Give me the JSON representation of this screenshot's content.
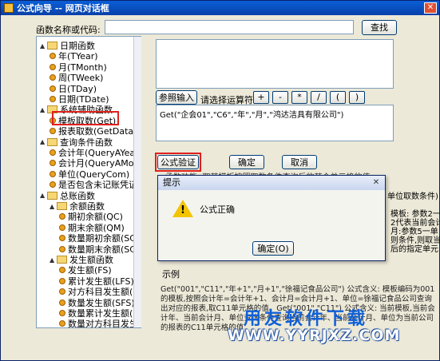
{
  "window": {
    "title": "公式向导 -- 网页对话框",
    "close_glyph": "✕"
  },
  "search": {
    "label": "函数名称或代码:",
    "value": "",
    "button": "查找"
  },
  "tree": {
    "items": [
      {
        "text": "日期函数",
        "kind": "folder",
        "expand": "▲",
        "level": 0
      },
      {
        "text": "年(TYear)",
        "kind": "leaf",
        "level": 1
      },
      {
        "text": "月(TMonth)",
        "kind": "leaf",
        "level": 1
      },
      {
        "text": "周(TWeek)",
        "kind": "leaf",
        "level": 1
      },
      {
        "text": "日(TDay)",
        "kind": "leaf",
        "level": 1
      },
      {
        "text": "日期(TDate)",
        "kind": "leaf",
        "level": 1
      },
      {
        "text": "系统辅助函数",
        "kind": "folder",
        "expand": "▲",
        "level": 0
      },
      {
        "text": "模板取数(Get)",
        "kind": "leaf",
        "level": 1
      },
      {
        "text": "报表取数(GetData)",
        "kind": "leaf",
        "level": 1
      },
      {
        "text": "查询条件函数",
        "kind": "folder",
        "expand": "▲",
        "level": 0
      },
      {
        "text": "会计年(QueryAYear)",
        "kind": "leaf",
        "level": 1
      },
      {
        "text": "会计月(QueryAMonth",
        "kind": "leaf",
        "level": 1
      },
      {
        "text": "单位(QueryCom)",
        "kind": "leaf",
        "level": 1
      },
      {
        "text": "是否包含未记账凭证(",
        "kind": "leaf",
        "level": 1
      },
      {
        "text": "总账函数",
        "kind": "folder",
        "expand": "▲",
        "level": 0
      },
      {
        "text": "余额函数",
        "kind": "folder",
        "expand": "▲",
        "level": 1
      },
      {
        "text": "期初余额(QC)",
        "kind": "leaf",
        "level": 2
      },
      {
        "text": "期末余额(QM)",
        "kind": "leaf",
        "level": 2
      },
      {
        "text": "数量期初余额(SC",
        "kind": "leaf",
        "level": 2
      },
      {
        "text": "数量期末余额(SC",
        "kind": "leaf",
        "level": 2
      },
      {
        "text": "发生额函数",
        "kind": "folder",
        "expand": "▲",
        "level": 1
      },
      {
        "text": "发生额(FS)",
        "kind": "leaf",
        "level": 2
      },
      {
        "text": "累计发生额(LFS)",
        "kind": "leaf",
        "level": 2
      },
      {
        "text": "对方科目发生额(",
        "kind": "leaf",
        "level": 2
      },
      {
        "text": "数量发生额(SFS)",
        "kind": "leaf",
        "level": 2
      },
      {
        "text": "数量累计发生额(",
        "kind": "leaf",
        "level": 2
      },
      {
        "text": "数量对方科目发生",
        "kind": "leaf",
        "level": 2
      }
    ]
  },
  "ref_button": "参照输入",
  "operator_label": "请选择运算符:",
  "operators": [
    "+",
    "-",
    "*",
    "/",
    "(",
    ")"
  ],
  "formula": "Get(\"企会01\",\"C6\",\"年\",\"月\",\"鸿达洁具有限公司\")",
  "buttons": {
    "verify": "公式验证",
    "ok": "确定",
    "cancel": "取消"
  },
  "desc_partial": "函数功能: 取某模板按照取数条件查询后的某个单元格的值",
  "right_fragments": [
    "单位取数条件)",
    "模板: 参数2一",
    "2代表当前会计",
    "月:参数5一单",
    "则条件,则取当",
    "后的指定单元"
  ],
  "dialog": {
    "title": "提示",
    "message": "公式正确",
    "ok": "确定(O)",
    "icon_glyph": "!"
  },
  "example": {
    "title": "示例",
    "text": "Get(\"001\",\"C11\",\"年+1\",\"月+1\",\"徐福记食品公司\") 公式含义: 模板编码为001的模板,按照会计年=会计年+1、会计月=会计月+1、单位=徐福记食品公司查询出对应的报表,取C11单元格的值。Get(\"001\",\"C11\") 公式含义: 当前模板,当前会计年、当前会计月、单位查询条件查询当前会计年、当前会计月、单位为当前公司的报表的C11单元格的值"
  },
  "watermark": {
    "line1": "用友软件下载",
    "line2": "WWW.YYRJXZ.COM"
  }
}
